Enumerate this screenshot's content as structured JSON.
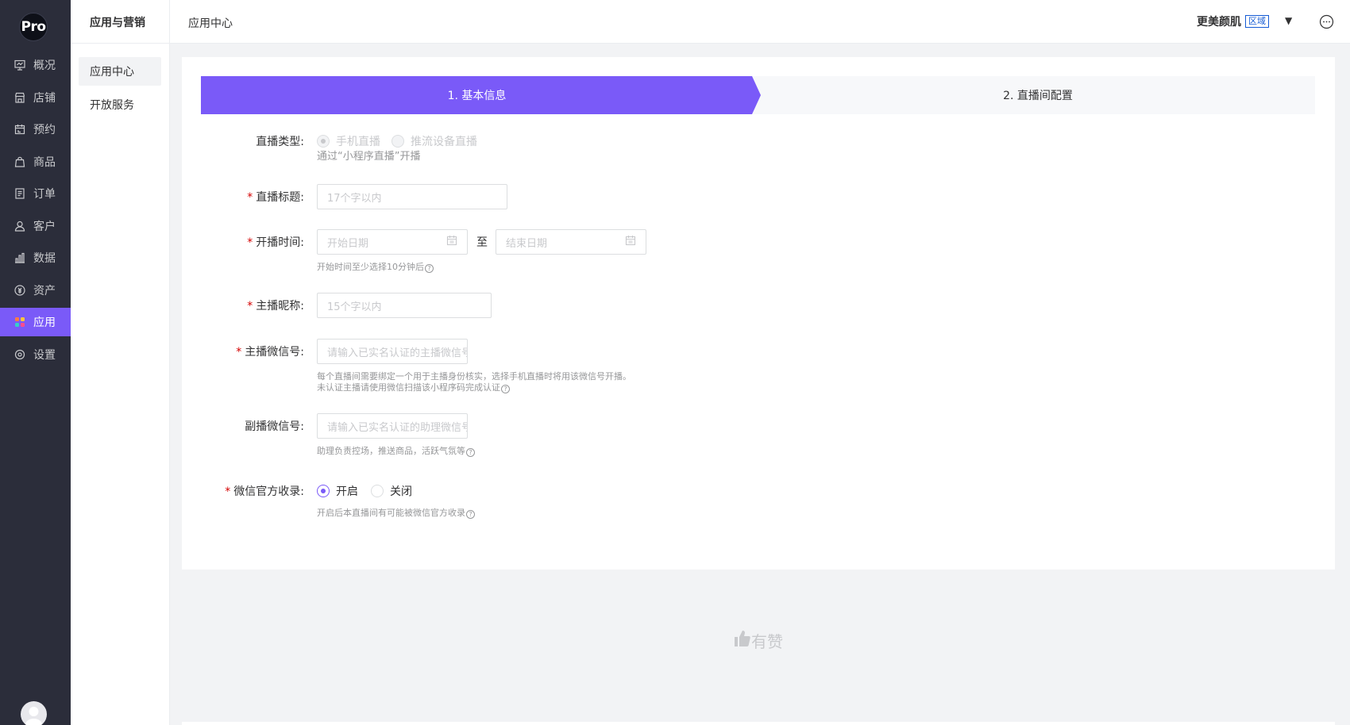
{
  "sidebar": {
    "logo_text": "Pro",
    "items": [
      {
        "label": "概况",
        "icon": "monitor-icon"
      },
      {
        "label": "店铺",
        "icon": "store-icon"
      },
      {
        "label": "预约",
        "icon": "calendar-icon"
      },
      {
        "label": "商品",
        "icon": "bag-icon"
      },
      {
        "label": "订单",
        "icon": "order-icon"
      },
      {
        "label": "客户",
        "icon": "user-icon"
      },
      {
        "label": "数据",
        "icon": "bar-chart-icon"
      },
      {
        "label": "资产",
        "icon": "coin-icon"
      },
      {
        "label": "应用",
        "icon": "apps-icon",
        "active": true
      },
      {
        "label": "设置",
        "icon": "gear-icon"
      }
    ],
    "accent_color": "#7a5af8"
  },
  "subnav": {
    "title": "应用与营销",
    "items": [
      {
        "label": "应用中心",
        "active": true
      },
      {
        "label": "开放服务"
      }
    ]
  },
  "header": {
    "breadcrumb": "应用中心",
    "shop_name": "更美颜肌",
    "shop_tag": "区域"
  },
  "steps": [
    {
      "label": "1. 基本信息",
      "active": true
    },
    {
      "label": "2. 直播间配置"
    }
  ],
  "form": {
    "live_type": {
      "label": "直播类型:",
      "options": [
        "手机直播",
        "推流设备直播"
      ],
      "help": "通过“小程序直播”开播"
    },
    "title": {
      "label": "直播标题:",
      "placeholder": "17个字以内"
    },
    "time": {
      "label": "开播时间:",
      "start_placeholder": "开始日期",
      "separator": "至",
      "end_placeholder": "结束日期",
      "help": "开始时间至少选择10分钟后"
    },
    "anchor_name": {
      "label": "主播昵称:",
      "placeholder": "15个字以内"
    },
    "anchor_wechat": {
      "label": "主播微信号:",
      "placeholder": "请输入已实名认证的主播微信号",
      "help_line1": "每个直播间需要绑定一个用于主播身份核实，选择手机直播时将用该微信号开播。",
      "help_line2": "未认证主播请使用微信扫描该小程序码完成认证"
    },
    "assistant_wechat": {
      "label": "副播微信号:",
      "placeholder": "请输入已实名认证的助理微信号",
      "help": "助理负责控场，推送商品，活跃气氛等"
    },
    "official_index": {
      "label": "微信官方收录:",
      "options": [
        "开启",
        "关闭"
      ],
      "selected": "开启",
      "help": "开启后本直播间有可能被微信官方收录"
    },
    "required_mark": "*",
    "help_icon": "?"
  },
  "footer": {
    "brand": "有赞"
  }
}
